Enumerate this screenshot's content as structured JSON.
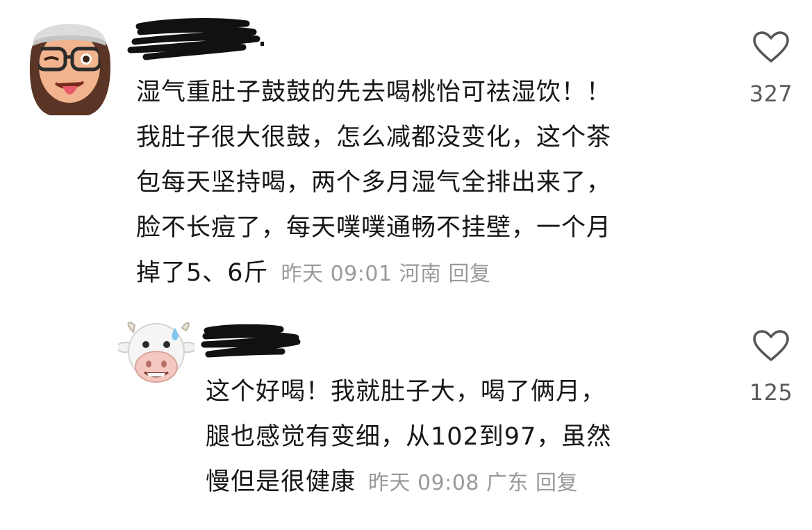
{
  "comments": [
    {
      "lines": [
        "湿气重肚子鼓鼓的先去喝桃怡可祛湿饮！！",
        "我肚子很大很鼓，怎么减都没变化，这个茶",
        "包每天坚持喝，两个多月湿气全排出来了，",
        "脸不长痘了，每天噗噗通畅不挂壁，一个月",
        "掉了5、6斤"
      ],
      "time": "昨天 09:01",
      "location": "河南",
      "reply_label": "回复",
      "likes": "327",
      "avatar_icon": "memoji-girl-glasses-icon"
    },
    {
      "lines": [
        "这个好喝！我就肚子大，喝了俩月，",
        "腿也感觉有变细，从102到97，虽然",
        "慢但是很健康"
      ],
      "time": "昨天 09:08",
      "location": "广东",
      "reply_label": "回复",
      "likes": "125",
      "avatar_icon": "cow-memoji-icon"
    }
  ],
  "colors": {
    "text": "#161616",
    "meta": "#9a9a9a",
    "count": "#5a5a5a"
  }
}
